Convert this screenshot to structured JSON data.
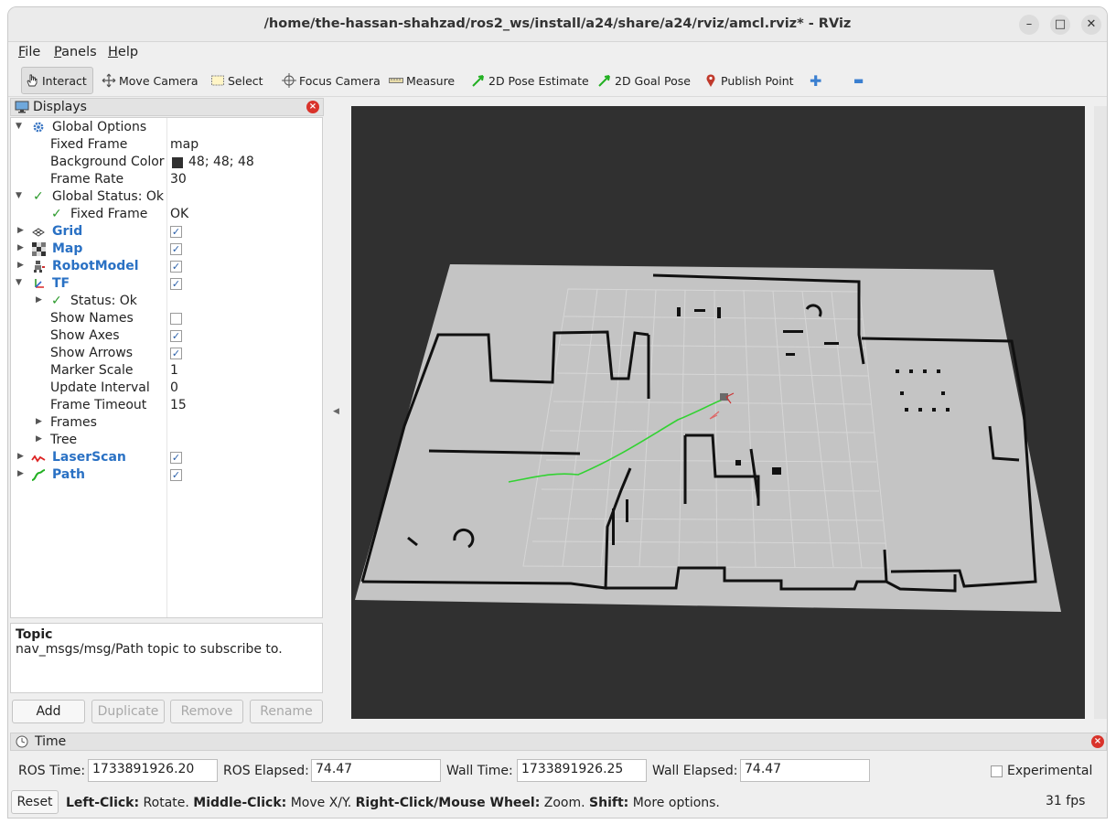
{
  "window": {
    "title": "/home/the-hassan-shahzad/ros2_ws/install/a24/share/a24/rviz/amcl.rviz* - RViz",
    "min_symbol": "–",
    "max_symbol": "□",
    "close_symbol": "✕"
  },
  "menu": [
    {
      "label": "File",
      "u": "F",
      "rest": "ile"
    },
    {
      "label": "Panels",
      "u": "P",
      "rest": "anels"
    },
    {
      "label": "Help",
      "u": "H",
      "rest": "elp"
    }
  ],
  "toolbar": {
    "interact": "Interact",
    "move_camera": "Move Camera",
    "select": "Select",
    "focus_camera": "Focus Camera",
    "measure": "Measure",
    "pose_estimate": "2D Pose Estimate",
    "goal_pose": "2D Goal Pose",
    "publish_point": "Publish Point",
    "add_symbol": "✚",
    "remove_symbol": "▬"
  },
  "displays": {
    "title": "Displays",
    "close_symbol": "×",
    "rows": {
      "global_options": "Global Options",
      "fixed_frame_label": "Fixed Frame",
      "fixed_frame_value": "map",
      "bg_color_label": "Background Color",
      "bg_color_value": "48; 48; 48",
      "frame_rate_label": "Frame Rate",
      "frame_rate_value": "30",
      "global_status": "Global Status: Ok",
      "gs_fixed_frame": "Fixed Frame",
      "gs_fixed_frame_value": "OK",
      "grid": "Grid",
      "map": "Map",
      "robot_model": "RobotModel",
      "tf": "TF",
      "tf_status": "Status: Ok",
      "show_names": "Show Names",
      "show_axes": "Show Axes",
      "show_arrows": "Show Arrows",
      "marker_scale": "Marker Scale",
      "marker_scale_value": "1",
      "update_interval": "Update Interval",
      "update_interval_value": "0",
      "frame_timeout": "Frame Timeout",
      "frame_timeout_value": "15",
      "frames": "Frames",
      "tree": "Tree",
      "laser_scan": "LaserScan",
      "path": "Path"
    },
    "check_symbol": "✓",
    "checks": {
      "grid": true,
      "map": true,
      "robot_model": true,
      "tf": true,
      "show_names": false,
      "show_axes": true,
      "show_arrows": true,
      "laser_scan": true,
      "path": true
    }
  },
  "description": {
    "title": "Topic",
    "text": "nav_msgs/msg/Path topic to subscribe to."
  },
  "panel_buttons": {
    "add": "Add",
    "duplicate": "Duplicate",
    "remove": "Remove",
    "rename": "Rename"
  },
  "time": {
    "title": "Time",
    "ros_time_label": "ROS Time:",
    "ros_time": "1733891926.20",
    "ros_elapsed_label": "ROS Elapsed:",
    "ros_elapsed": "74.47",
    "wall_time_label": "Wall Time:",
    "wall_time": "1733891926.25",
    "wall_elapsed_label": "Wall Elapsed:",
    "wall_elapsed": "74.47",
    "experimental": "Experimental"
  },
  "status": {
    "reset": "Reset",
    "k1": "Left-Click:",
    "v1": " Rotate. ",
    "k2": "Middle-Click:",
    "v2": " Move X/Y. ",
    "k3": "Right-Click/Mouse Wheel:",
    "v3": " Zoom. ",
    "k4": "Shift:",
    "v4": " More options.",
    "fps": "31 fps"
  },
  "colors": {
    "background": "#303030",
    "map_free": "#c4c4c4",
    "path": "#32d232",
    "link_blue": "#2a71c4"
  }
}
